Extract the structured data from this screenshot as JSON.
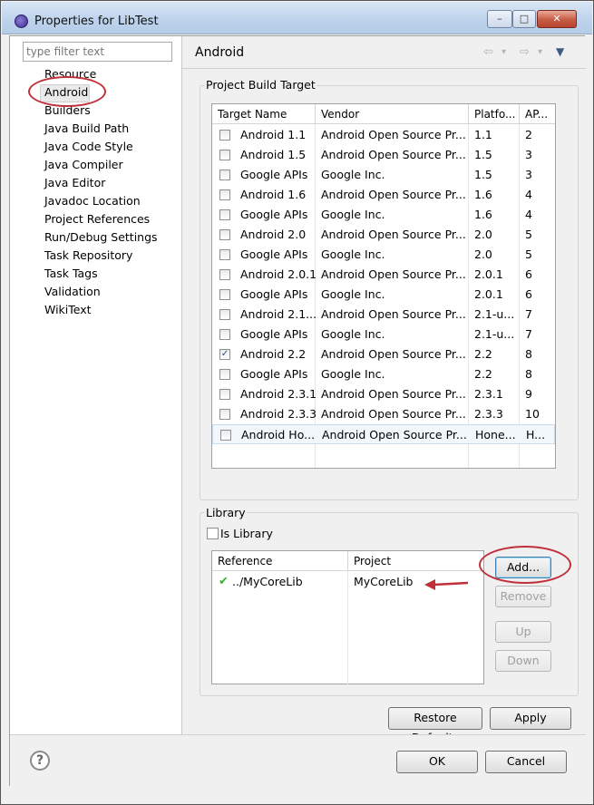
{
  "window": {
    "title": "Properties for LibTest",
    "min": "–",
    "max": "□",
    "close": "✕"
  },
  "filter": {
    "placeholder": "type filter text"
  },
  "nav": [
    "Resource",
    "Android",
    "Builders",
    "Java Build Path",
    "Java Code Style",
    "Java Compiler",
    "Java Editor",
    "Javadoc Location",
    "Project References",
    "Run/Debug Settings",
    "Task Repository",
    "Task Tags",
    "Validation",
    "WikiText"
  ],
  "nav_selected": "Android",
  "page": {
    "title": "Android",
    "back": "⇦",
    "fwd": "⇨",
    "dropdown": "▾",
    "menu": "▼"
  },
  "build_target": {
    "group_label": "Project Build Target",
    "columns": [
      "Target Name",
      "Vendor",
      "Platfo...",
      "AP..."
    ],
    "rows": [
      {
        "checked": false,
        "name": "Android 1.1",
        "vendor": "Android Open Source Pr...",
        "platform": "1.1",
        "api": "2"
      },
      {
        "checked": false,
        "name": "Android 1.5",
        "vendor": "Android Open Source Pr...",
        "platform": "1.5",
        "api": "3"
      },
      {
        "checked": false,
        "name": "Google APIs",
        "vendor": "Google Inc.",
        "platform": "1.5",
        "api": "3"
      },
      {
        "checked": false,
        "name": "Android 1.6",
        "vendor": "Android Open Source Pr...",
        "platform": "1.6",
        "api": "4"
      },
      {
        "checked": false,
        "name": "Google APIs",
        "vendor": "Google Inc.",
        "platform": "1.6",
        "api": "4"
      },
      {
        "checked": false,
        "name": "Android 2.0",
        "vendor": "Android Open Source Pr...",
        "platform": "2.0",
        "api": "5"
      },
      {
        "checked": false,
        "name": "Google APIs",
        "vendor": "Google Inc.",
        "platform": "2.0",
        "api": "5"
      },
      {
        "checked": false,
        "name": "Android 2.0.1",
        "vendor": "Android Open Source Pr...",
        "platform": "2.0.1",
        "api": "6"
      },
      {
        "checked": false,
        "name": "Google APIs",
        "vendor": "Google Inc.",
        "platform": "2.0.1",
        "api": "6"
      },
      {
        "checked": false,
        "name": "Android 2.1...",
        "vendor": "Android Open Source Pr...",
        "platform": "2.1-u...",
        "api": "7"
      },
      {
        "checked": false,
        "name": "Google APIs",
        "vendor": "Google Inc.",
        "platform": "2.1-u...",
        "api": "7"
      },
      {
        "checked": true,
        "name": "Android 2.2",
        "vendor": "Android Open Source Pr...",
        "platform": "2.2",
        "api": "8"
      },
      {
        "checked": false,
        "name": "Google APIs",
        "vendor": "Google Inc.",
        "platform": "2.2",
        "api": "8"
      },
      {
        "checked": false,
        "name": "Android 2.3.1",
        "vendor": "Android Open Source Pr...",
        "platform": "2.3.1",
        "api": "9"
      },
      {
        "checked": false,
        "name": "Android 2.3.3",
        "vendor": "Android Open Source Pr...",
        "platform": "2.3.3",
        "api": "10"
      },
      {
        "checked": false,
        "name": "Android Ho...",
        "vendor": "Android Open Source Pr...",
        "platform": "Hone...",
        "api": "H..."
      }
    ],
    "selected_row": 15
  },
  "library": {
    "group_label": "Library",
    "is_library_label": "Is Library",
    "is_library": false,
    "columns": [
      "Reference",
      "Project"
    ],
    "rows": [
      {
        "reference": "../MyCoreLib",
        "project": "MyCoreLib"
      }
    ],
    "check_glyph": "✔",
    "arrow_color": "#c0303a",
    "add": "Add...",
    "remove": "Remove",
    "up": "Up",
    "down": "Down"
  },
  "buttons": {
    "restore": "Restore Defaults",
    "apply": "Apply",
    "ok": "OK",
    "cancel": "Cancel",
    "help": "?"
  },
  "colors": {
    "annotation": "#c0303a",
    "check_green": "#2fb42f"
  }
}
